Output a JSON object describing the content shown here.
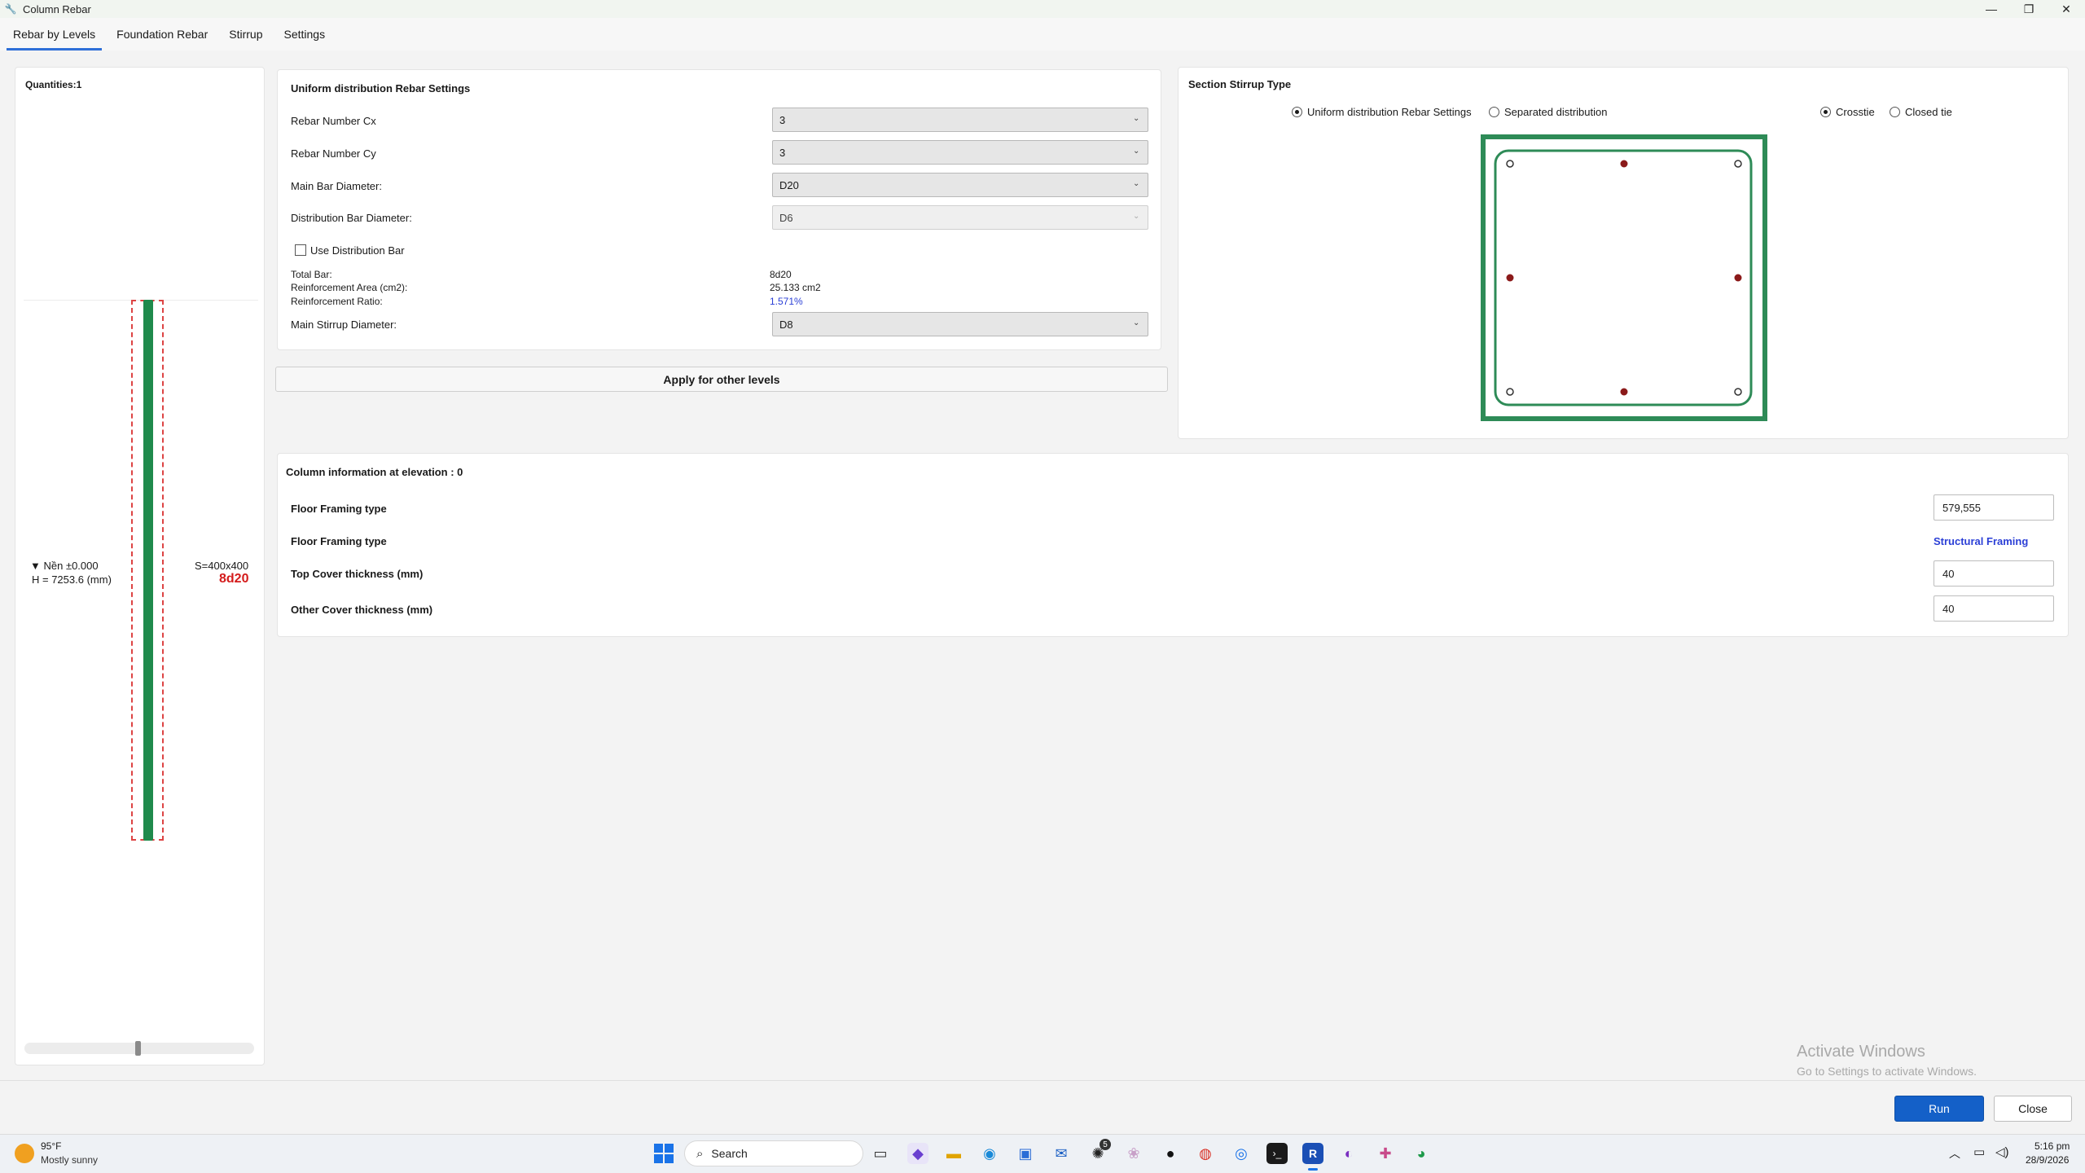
{
  "window": {
    "title": "Column Rebar"
  },
  "tabs": [
    "Rebar by Levels",
    "Foundation Rebar",
    "Stirrup",
    "Settings"
  ],
  "left_panel": {
    "quantities": "Quantities:1",
    "level_name": "▼ Nền ±0.000",
    "height": "H = 7253.6 (mm)",
    "section": "S=400x400",
    "rebar_label": "8d20",
    "slider_value": 0.5
  },
  "settings": {
    "title": "Uniform distribution Rebar Settings",
    "rebar_cx_label": "Rebar Number Cx",
    "rebar_cx_value": "3",
    "rebar_cy_label": "Rebar Number Cy",
    "rebar_cy_value": "3",
    "main_dia_label": "Main Bar Diameter:",
    "main_dia_value": "D20",
    "dist_dia_label": "Distribution Bar Diameter:",
    "dist_dia_value": "D6",
    "use_dist_label": "Use Distribution Bar",
    "total_bar_label": "Total Bar:",
    "total_bar_value": "8d20",
    "area_label": "Reinforcement Area (cm2):",
    "area_value": "25.133 cm2",
    "ratio_label": "Reinforcement Ratio:",
    "ratio_value": "1.571%",
    "stirrup_dia_label": "Main Stirrup Diameter:",
    "stirrup_dia_value": "D8",
    "apply_button": "Apply for other levels"
  },
  "section": {
    "title": "Section Stirrup Type",
    "radio_uniform": "Uniform distribution Rebar Settings",
    "radio_separated": "Separated distribution",
    "radio_crosstie": "Crosstie",
    "radio_closed": "Closed tie",
    "colors": {
      "frame": "#2e8b57",
      "bar": "#8b1a1a"
    }
  },
  "column_info": {
    "title": "Column information at elevation : 0",
    "row1_label": "Floor Framing type",
    "row1_value": "579,555",
    "row2_label": "Floor Framing type",
    "row2_value": "Structural Framing",
    "row3_label": "Top Cover thickness (mm)",
    "row3_value": "40",
    "row4_label": "Other Cover thickness (mm)",
    "row4_value": "40"
  },
  "watermark": {
    "line1": "Activate Windows",
    "line2": "Go to Settings to activate Windows."
  },
  "footer": {
    "run": "Run",
    "close": "Close"
  },
  "taskbar": {
    "weather_temp": "95°F",
    "weather_desc": "Mostly sunny",
    "search": "Search",
    "time": "5:16 pm",
    "date": "28/9/2026",
    "badge": "5"
  }
}
